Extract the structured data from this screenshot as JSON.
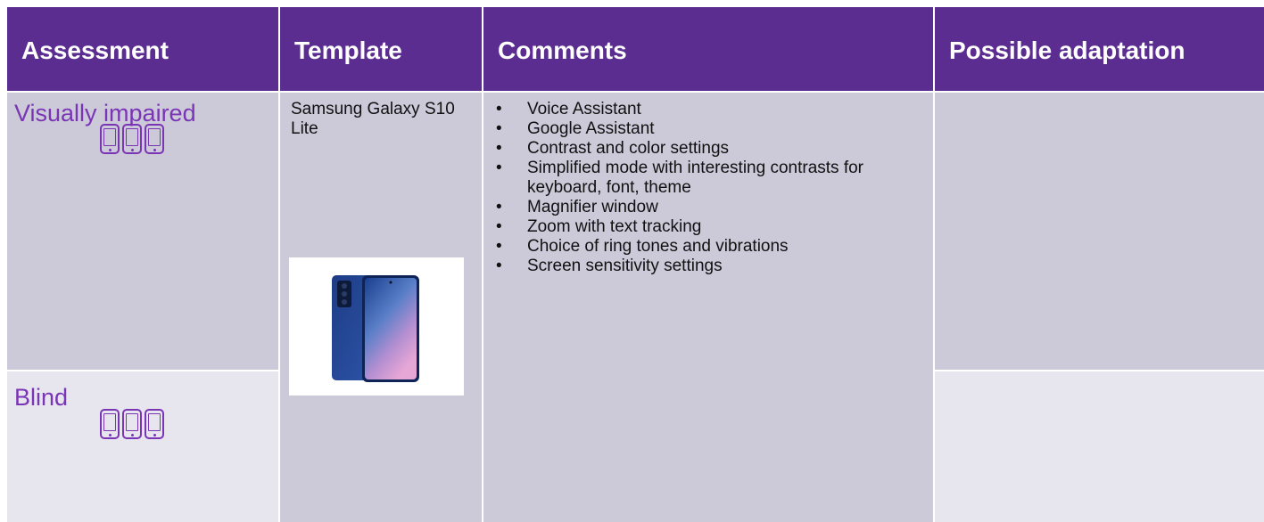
{
  "table": {
    "headers": [
      "Assessment",
      "Template",
      "Comments",
      "Possible adaptation"
    ],
    "rows": [
      {
        "assessment": "Visually impaired"
      },
      {
        "assessment": "Blind"
      }
    ],
    "template": {
      "name": "Samsung Galaxy S10 Lite",
      "image_icon": "smartphone-product-photo"
    },
    "comments": [
      "Voice Assistant",
      "Google Assistant",
      "Contrast and color settings",
      "Simplified mode with interesting contrasts for keyboard, font, theme",
      "Magnifier window",
      "Zoom with text tracking",
      "Choice of ring tones and vibrations",
      "Screen sensitivity settings"
    ],
    "bullet_char": "•",
    "adaptation": [
      "",
      ""
    ]
  },
  "colors": {
    "header_bg": "#5b2d91",
    "header_text": "#ffffff",
    "row_bg_dark": "#ccc9d9",
    "row_bg_light": "#e7e5ee",
    "assessment_text": "#7a35b5"
  },
  "icons": {
    "phone_rating": "smartphone-icon"
  }
}
